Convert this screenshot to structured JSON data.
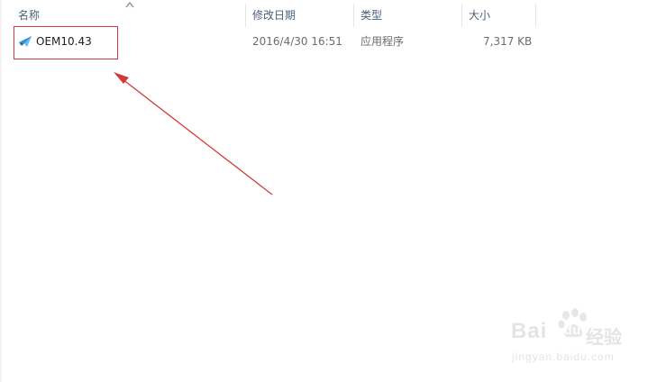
{
  "columns": {
    "name": "名称",
    "modified": "修改日期",
    "type": "类型",
    "size": "大小"
  },
  "files": [
    {
      "name": "OEM10.43",
      "modified": "2016/4/30 16:51",
      "type": "应用程序",
      "size": "7,317 KB",
      "icon": "application-icon"
    }
  ],
  "watermark": {
    "brand": "Bai",
    "brand_suffix": "du",
    "cn": "经验",
    "url": "jingyan.baidu.com"
  },
  "colors": {
    "header_text": "#4c607a",
    "annotation_red": "#d23a3a",
    "icon_blue": "#2b8fd6"
  }
}
